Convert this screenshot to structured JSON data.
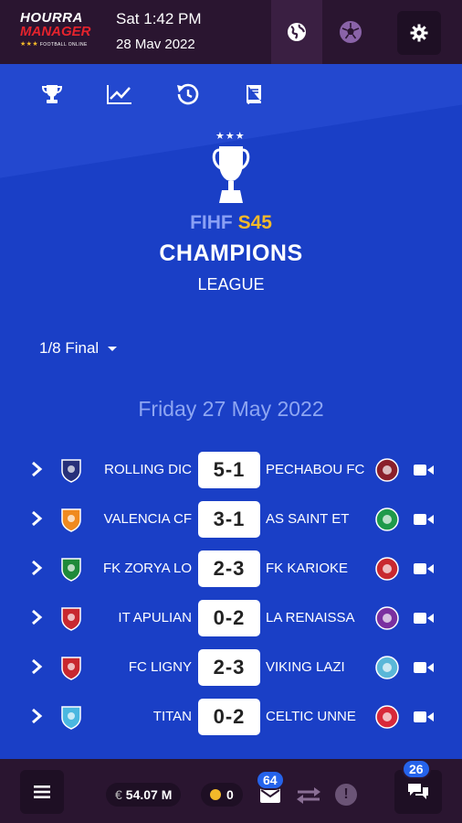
{
  "header": {
    "logo_line1": "HOURRA",
    "logo_line2": "MANAGER",
    "logo_tagline": "FOOTBALL ONLINE",
    "time": "Sat 1:42 PM",
    "date": "28 Mav 2022",
    "icons": [
      "globe-icon",
      "soccer-ball-icon",
      "gear-icon"
    ]
  },
  "nav_icons": [
    "trophy-icon",
    "chart-icon",
    "history-icon",
    "book-icon"
  ],
  "competition": {
    "line1_prefix": "FIHF",
    "line1_season": "S45",
    "line2": "CHAMPIONS",
    "line3": "LEAGUE",
    "stars": "★★★"
  },
  "round_selector": "1/8 Final",
  "day_heading": "Friday 27 May 2022",
  "matches": [
    {
      "home": "ROLLING DIC",
      "score": "5-1",
      "away": "PECHABOU FC",
      "home_color": "#27307a",
      "away_color": "#8a1f2a"
    },
    {
      "home": "VALENCIA CF",
      "score": "3-1",
      "away": "AS SAINT ET",
      "home_color": "#f08a1f",
      "away_color": "#1f9a4a"
    },
    {
      "home": "FK ZORYA LO",
      "score": "2-3",
      "away": "FK KARIOKE",
      "home_color": "#1f8a3a",
      "away_color": "#c8282f"
    },
    {
      "home": "IT APULIAN",
      "score": "0-2",
      "away": "LA RENAISSA",
      "home_color": "#c8282f",
      "away_color": "#7a2fa0"
    },
    {
      "home": "FC LIGNY",
      "score": "2-3",
      "away": "VIKING LAZI",
      "home_color": "#c8282f",
      "away_color": "#5ab7d8"
    },
    {
      "home": "TITAN",
      "score": "0-2",
      "away": "CELTIC UNNE",
      "home_color": "#4ab7e0",
      "away_color": "#d8283a"
    }
  ],
  "bottom": {
    "currency_symbol": "€",
    "money": "54.07 M",
    "coins": "0",
    "mail_count": "64",
    "chat_count": "26",
    "alert": "!"
  },
  "colors": {
    "bar_bg": "#2a1530",
    "main_bg": "#1a3fc6",
    "accent_gold": "#f3b92a",
    "badge_blue": "#2563eb"
  }
}
